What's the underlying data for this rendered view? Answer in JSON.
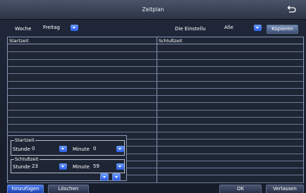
{
  "window": {
    "title": "Zeitplan",
    "back_icon": "return-arrow-icon"
  },
  "filters": {
    "day_label": "Woche",
    "day_value": "Freitag",
    "setting_label": "Die Einstellu",
    "setting_value": "Alle",
    "copy_label": "Kopieren"
  },
  "table": {
    "columns": [
      "Startzeit",
      "Schlußzeit"
    ],
    "rows": []
  },
  "editor": {
    "start_group": "Startzeit",
    "end_group": "Schlußzeit",
    "hour_label": "Stunde",
    "minute_label": "Minute",
    "start_hour": "0",
    "start_minute": "0",
    "end_hour": "23",
    "end_minute": "59"
  },
  "footer": {
    "add_label": "hinzufügen",
    "delete_label": "Löschen",
    "ok_label": "OK",
    "leave_label": "Verlassen"
  },
  "colors": {
    "accent_blue": "#2a5ae0",
    "titlebar": "#3a4458",
    "background": "#1a2030"
  }
}
